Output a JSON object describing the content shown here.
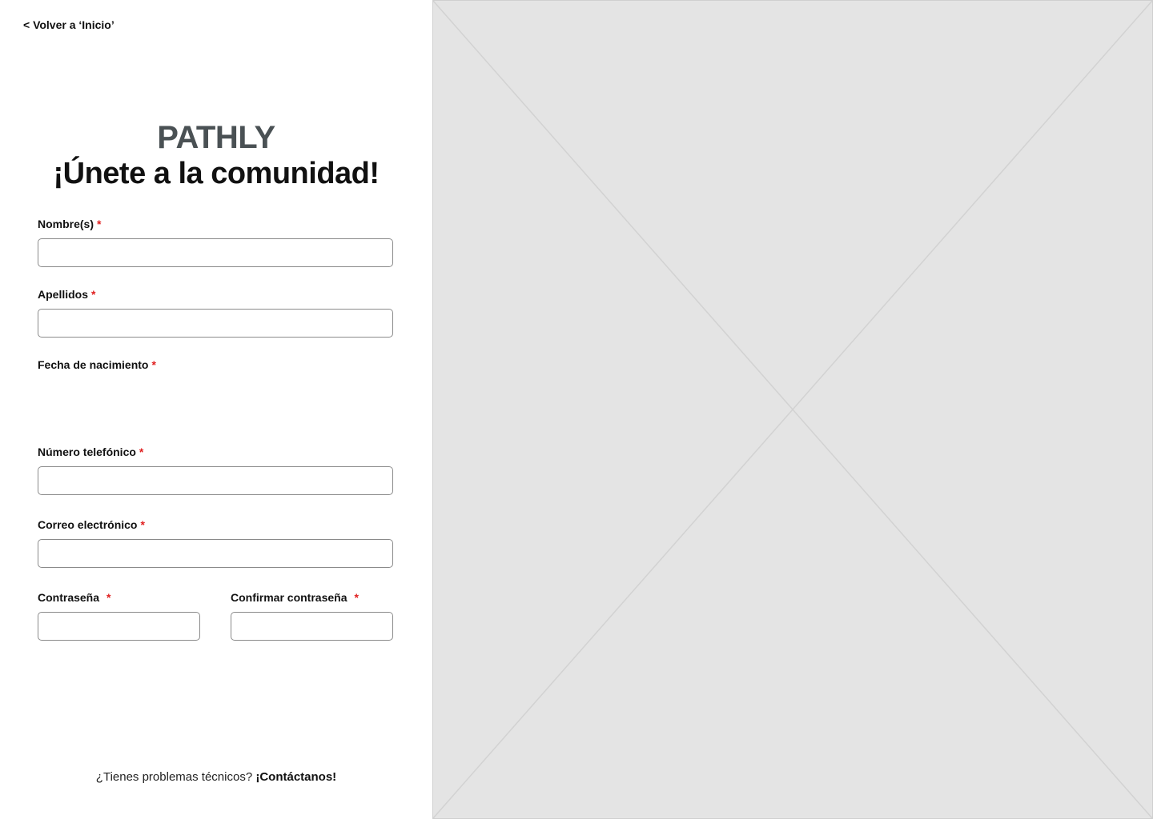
{
  "back_link": {
    "label": "< Volver a ‘Inicio’"
  },
  "brand": {
    "name": "PATHLY"
  },
  "headline": "¡Únete a la comunidad!",
  "form": {
    "required_mark": "*",
    "first_name": {
      "label": "Nombre(s)",
      "value": ""
    },
    "last_name": {
      "label": "Apellidos",
      "value": ""
    },
    "birth_date": {
      "label": "Fecha de nacimiento"
    },
    "phone": {
      "label": "Número telefónico",
      "value": ""
    },
    "email": {
      "label": "Correo electrónico",
      "value": ""
    },
    "password": {
      "label": "Contraseña",
      "value": ""
    },
    "confirm_password": {
      "label": "Confirmar contraseña",
      "value": ""
    }
  },
  "help": {
    "question": "¿Tienes problemas técnicos?",
    "contact_link": "¡Contáctanos!"
  },
  "image_placeholder": {
    "icon": "image-placeholder-icon"
  },
  "colors": {
    "brand": "#4a5154",
    "required": "#e02020",
    "placeholder_bg": "#e4e4e4",
    "field_border": "#8a8a8a"
  }
}
